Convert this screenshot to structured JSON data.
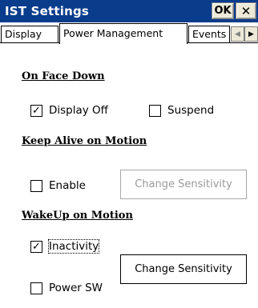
{
  "window": {
    "title": "IST Settings",
    "ok_label": "OK",
    "close_label": "✕"
  },
  "tabs": [
    {
      "label": "Display",
      "selected": false
    },
    {
      "label": "Power Management",
      "selected": true
    },
    {
      "label": "Events",
      "selected": false
    }
  ],
  "tab_scroll": {
    "left_icon": "triangle-left",
    "right_icon": "triangle-right"
  },
  "sections": {
    "face_down": {
      "heading": "On Face Down",
      "display_off": {
        "label": "Display Off",
        "checked": true
      },
      "suspend": {
        "label": "Suspend",
        "checked": false
      }
    },
    "keep_alive": {
      "heading": "Keep Alive on Motion",
      "enable": {
        "label": "Enable",
        "checked": false
      },
      "change_sensitivity": {
        "label": "Change Sensitivity",
        "enabled": false
      }
    },
    "wakeup": {
      "heading": "WakeUp on Motion",
      "inactivity": {
        "label": "Inactivity",
        "checked": true
      },
      "power_sw": {
        "label": "Power SW",
        "checked": false
      },
      "change_sensitivity": {
        "label": "Change Sensitivity",
        "enabled": true
      }
    }
  },
  "colors": {
    "titlebar": "#0a3c8c",
    "disabled_text": "#9a9a9a"
  }
}
